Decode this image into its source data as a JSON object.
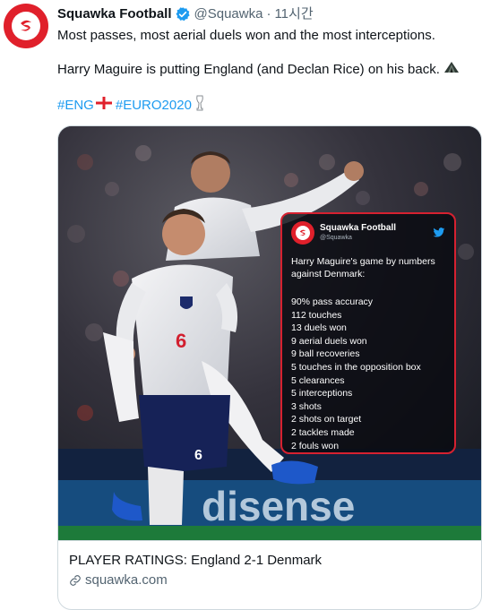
{
  "tweet": {
    "display_name": "Squawka Football",
    "handle": "@Squawka",
    "dot": "·",
    "time": "11시간",
    "text_line1": "Most passes, most aerial duels won and the most interceptions.",
    "text_line2": "Harry Maguire is putting England (and Declan Rice) on his back.",
    "hashtags": [
      "#ENG",
      "#EURO2020"
    ]
  },
  "link_card": {
    "title": "PLAYER RATINGS: England 2-1 Denmark",
    "domain": "squawka.com"
  },
  "image_overlay": {
    "account_name": "Squawka Football",
    "account_handle": "@Squawka",
    "intro": "Harry Maguire's game by numbers against Denmark:",
    "stats": [
      "90% pass accuracy",
      "112 touches",
      "13 duels won",
      "9 aerial duels won",
      "9 ball recoveries",
      "5 touches in the opposition box",
      "5 clearances",
      "5 interceptions",
      "3 shots",
      "2 shots on target",
      "2 tackles made",
      "2 fouls won"
    ]
  },
  "photo": {
    "shirt_number": "6",
    "shorts_number": "6",
    "ad_board": "disense"
  },
  "colors": {
    "accent_blue": "#1d9bf0",
    "brand_red": "#e0202b",
    "text": "#0f1419",
    "muted": "#536471"
  },
  "icons": [
    "squawka-logo-icon",
    "verified-badge-icon",
    "england-flag-icon",
    "trophy-icon",
    "tent-icon",
    "link-icon",
    "twitter-bird-icon"
  ]
}
